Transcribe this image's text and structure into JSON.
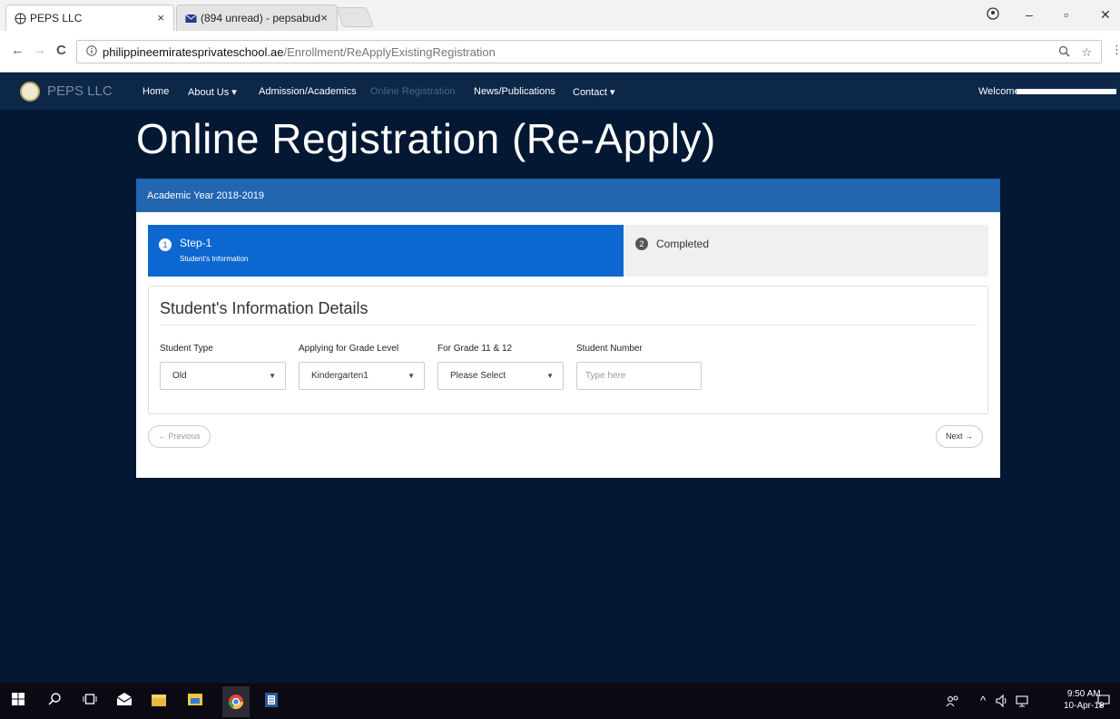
{
  "browser": {
    "tabs": [
      {
        "title": "PEPS LLC"
      },
      {
        "title": "(894 unread) - pepsabud"
      }
    ],
    "tab_close": "×",
    "url_host": "philippineemiratesprivateschool.ae",
    "url_path": "/Enrollment/ReApplyExistingRegistration",
    "window_controls": {
      "minimize": "–",
      "maximize": "▫",
      "close": "✕"
    },
    "nav": {
      "back": "←",
      "forward": "→",
      "reload": "C"
    }
  },
  "site": {
    "brand": "PEPS LLC",
    "nav": [
      {
        "label": "Home"
      },
      {
        "label": "About Us ▾"
      },
      {
        "label": "Admission/Academics"
      },
      {
        "label": "Online Registration"
      },
      {
        "label": "News/Publications"
      },
      {
        "label": "Contact ▾"
      }
    ],
    "welcome": "Welcome"
  },
  "page": {
    "title": "Online Registration (Re-Apply)",
    "academic_year": "Academic Year 2018-2019",
    "steps": [
      {
        "num": "1",
        "title": "Step-1",
        "subtitle": "Student's Information",
        "active": true
      },
      {
        "num": "2",
        "title": "Completed",
        "active": false
      }
    ],
    "section_title": "Student's Information Details",
    "fields": {
      "student_type": {
        "label": "Student Type",
        "value": "Old"
      },
      "grade_level": {
        "label": "Applying for Grade Level",
        "value": "Kindergarten1"
      },
      "grade_11_12": {
        "label": "For Grade 11 & 12",
        "value": "Please Select"
      },
      "student_number": {
        "label": "Student Number",
        "placeholder": "Type here"
      }
    },
    "prev_label": "← Previous",
    "next_label": "Next →"
  },
  "taskbar": {
    "time": "9:50 AM",
    "date": "10-Apr-18"
  },
  "colors": {
    "background": "#041833",
    "navbar": "#0c2748",
    "card_header": "#2266b0",
    "active_step": "#0d67d0"
  }
}
